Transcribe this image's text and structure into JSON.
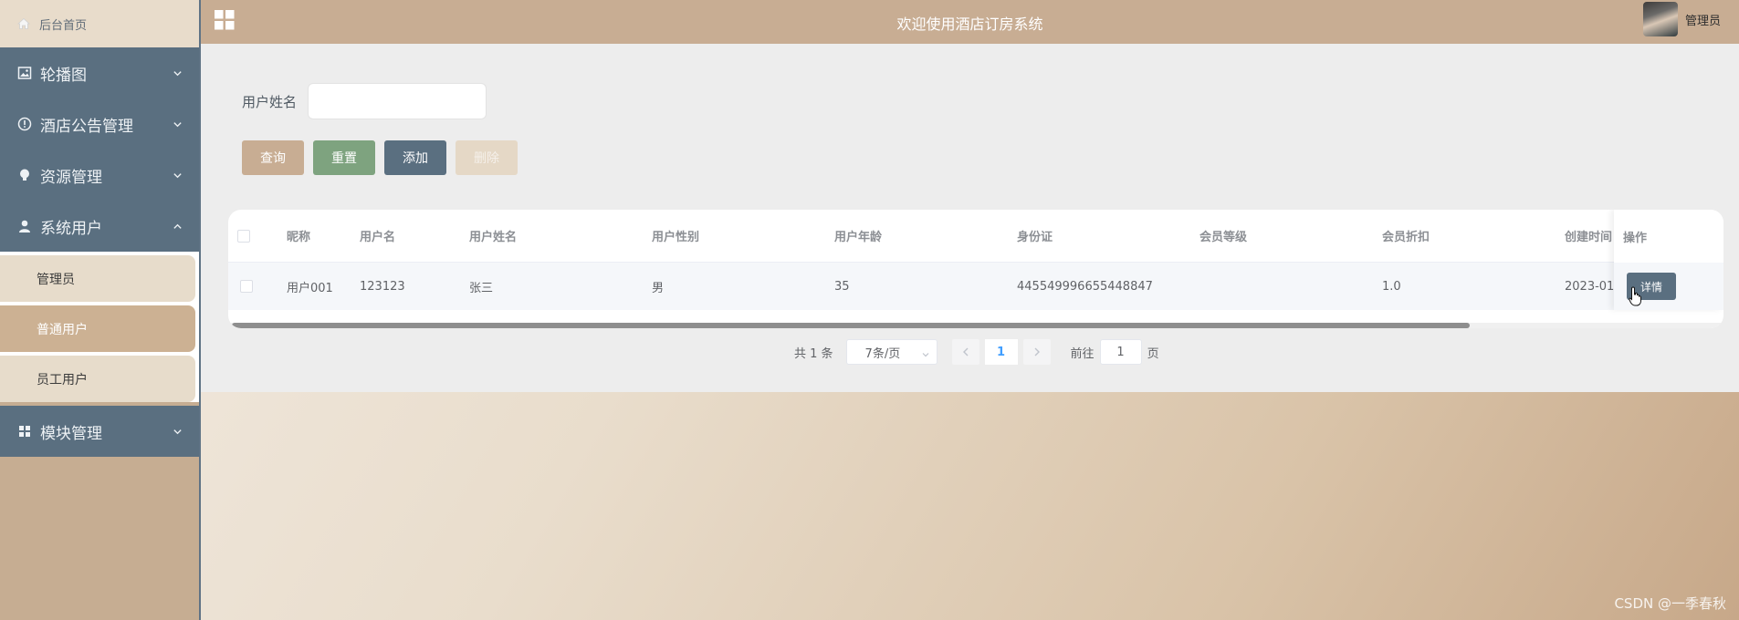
{
  "sidebar": {
    "home_label": "后台首页",
    "menus": [
      {
        "label": "轮播图",
        "icon": "image-icon"
      },
      {
        "label": "酒店公告管理",
        "icon": "info-icon"
      },
      {
        "label": "资源管理",
        "icon": "bulb-icon"
      },
      {
        "label": "系统用户",
        "icon": "user-icon"
      }
    ],
    "submenu": [
      {
        "label": "管理员"
      },
      {
        "label": "普通用户"
      },
      {
        "label": "员工用户"
      }
    ],
    "module_menu": {
      "label": "模块管理",
      "icon": "grid-icon"
    }
  },
  "topbar": {
    "title": "欢迎使用酒店订房系统",
    "user_name": "管理员"
  },
  "search": {
    "label": "用户姓名",
    "value": "",
    "placeholder": ""
  },
  "buttons": {
    "query": "查询",
    "reset": "重置",
    "add": "添加",
    "delete": "删除"
  },
  "table": {
    "columns": [
      "昵称",
      "用户名",
      "用户姓名",
      "用户性别",
      "用户年龄",
      "身份证",
      "会员等级",
      "会员折扣",
      "创建时间",
      "操作"
    ],
    "rows": [
      {
        "nickname": "用户001",
        "username": "123123",
        "realname": "张三",
        "gender": "男",
        "age": "35",
        "idcard": "445549996655448847",
        "level": "",
        "discount": "1.0",
        "created": "2023-01-",
        "action": "详情"
      }
    ]
  },
  "pagination": {
    "total": "共 1 条",
    "page_size": "7条/页",
    "current_page": "1",
    "goto_label": "前往",
    "goto_value": "1",
    "page_suffix": "页"
  },
  "watermark": "CSDN @一季春秋",
  "colors": {
    "sidebar_menu": "#5a6f80",
    "topbar": "#c8ad93",
    "submenu_active": "#ccb193",
    "reset_button": "#7ea37f"
  }
}
